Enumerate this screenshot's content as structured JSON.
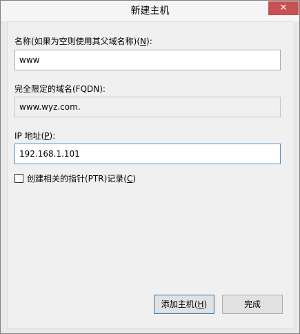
{
  "window": {
    "title": "新建主机",
    "close_glyph": "✕"
  },
  "name_field": {
    "label_pre": "名称(如果为空则使用其父域名称)(",
    "label_key": "N",
    "label_post": "):",
    "value": "www"
  },
  "fqdn_field": {
    "label": "完全限定的域名(FQDN):",
    "value": "www.wyz.com."
  },
  "ip_field": {
    "label_pre": "IP 地址(",
    "label_key": "P",
    "label_post": "):",
    "value": "192.168.1.101"
  },
  "ptr_checkbox": {
    "label_pre": "创建相关的指针(PTR)记录(",
    "label_key": "C",
    "label_post": ")",
    "checked": false
  },
  "buttons": {
    "add_pre": "添加主机(",
    "add_key": "H",
    "add_post": ")",
    "done": "完成"
  }
}
